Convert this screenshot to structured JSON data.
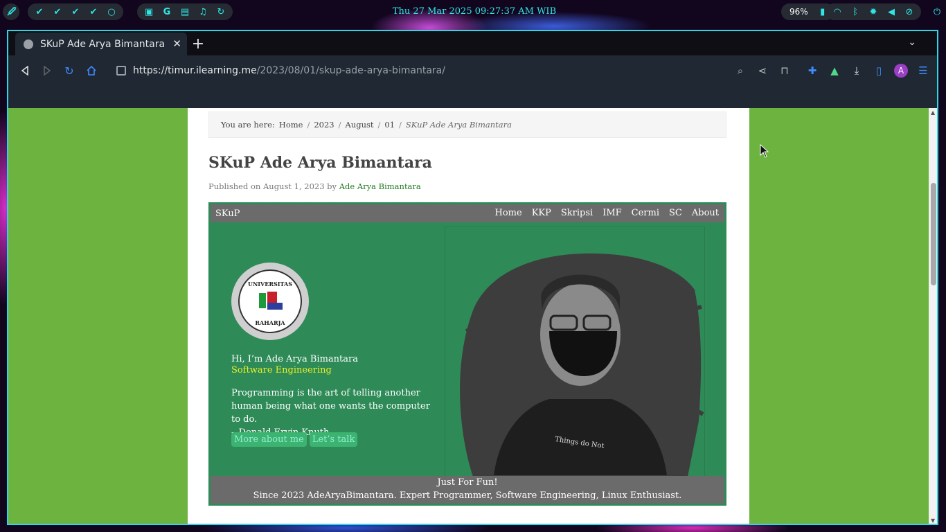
{
  "system": {
    "clock": "Thu 27 Mar 2025 09:27:37 AM WIB",
    "battery": "96%",
    "accent": "#2ee6e6"
  },
  "browser": {
    "tab_title": "SKuP Ade Arya Bimantara",
    "url_host": "https://timur.ilearning.me",
    "url_path": "/2023/08/01/skup-ade-arya-bimantara/"
  },
  "page": {
    "breadcrumb": {
      "prefix": "You are here:",
      "items": [
        "Home",
        "2023",
        "August",
        "01"
      ],
      "current": "SKuP Ade Arya Bimantara"
    },
    "title": "SKuP Ade Arya Bimantara",
    "meta_prefix": "Published on August 1, 2023 by",
    "author": "Ade Arya Bimantara"
  },
  "hero": {
    "brand": "SKuP",
    "nav": [
      "Home",
      "KKP",
      "Skripsi",
      "IMF",
      "Cermi",
      "SC",
      "About"
    ],
    "logo_top": "UNIVERSITAS",
    "logo_bottom": "RAHARJA",
    "greeting": "Hi, I’m Ade Arya Bimantara",
    "role": "Software Engineering",
    "quote_line1": "Programming is the art of telling another human being what one wants the computer to do.",
    "quote_author": "– Donald Ervin Knuth",
    "btn_about": "More about me",
    "btn_talk": "Let’s talk",
    "shirt_text": "Things do Not",
    "footer_line1": "Just For Fun!",
    "footer_line2": "Since 2023 AdeAryaBimantara. Expert Programmer, Software Engineering, Linux Enthusiast."
  }
}
